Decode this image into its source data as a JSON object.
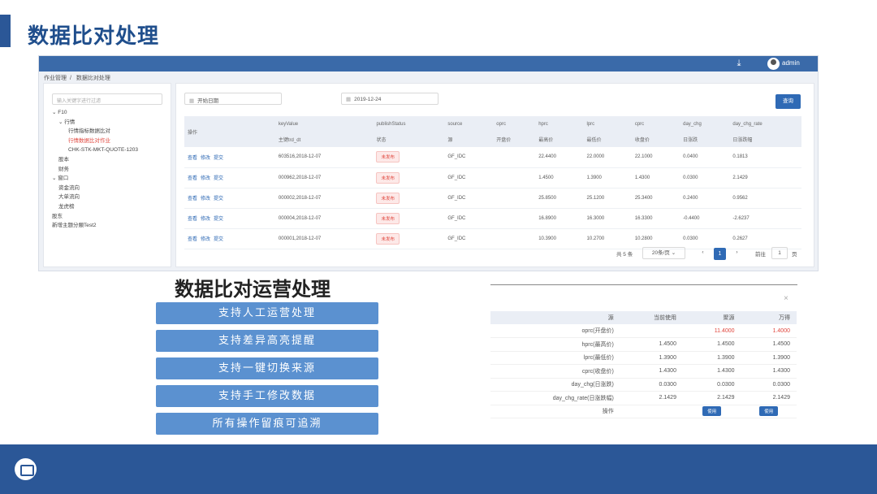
{
  "slide": {
    "title": "数据比对处理",
    "subtitle": "数据比对运营处理"
  },
  "topbar": {
    "user": "admin",
    "download_icon": "download-icon",
    "avatar_icon": "avatar-icon"
  },
  "breadcrumb": [
    "作业管理",
    "数据比对处理"
  ],
  "sidebar": {
    "search_placeholder": "输入关键字进行过滤",
    "tree": [
      {
        "label": "F10",
        "level": 0,
        "expanded": true
      },
      {
        "label": "行情",
        "level": 1,
        "expanded": true
      },
      {
        "label": "行情指标数据比对",
        "level": 2
      },
      {
        "label": "行情数据比对作业",
        "level": 2,
        "selected": true
      },
      {
        "label": "CHK-STK-MKT-QUOTE-1203",
        "level": 2
      },
      {
        "label": "股本",
        "level": 1
      },
      {
        "label": "财务",
        "level": 1
      },
      {
        "label": "窗口",
        "level": 0,
        "expanded": true
      },
      {
        "label": "资金流向",
        "level": 1
      },
      {
        "label": "大单流向",
        "level": 1
      },
      {
        "label": "龙虎榜",
        "level": 1
      },
      {
        "label": "股东",
        "level": 0
      },
      {
        "label": "新增主题分類Test2",
        "level": 0
      }
    ]
  },
  "filters": {
    "start_date_placeholder": "开始日期",
    "end_date": "2019-12-24",
    "query_label": "查询"
  },
  "table": {
    "headers": [
      {
        "top": "操作",
        "bottom": ""
      },
      {
        "top": "keyValue",
        "bottom": "主键trd_dt"
      },
      {
        "top": "publishStatus",
        "bottom": "状态"
      },
      {
        "top": "source",
        "bottom": "源"
      },
      {
        "top": "oprc",
        "bottom": "开盘价"
      },
      {
        "top": "hprc",
        "bottom": "最高价"
      },
      {
        "top": "lprc",
        "bottom": "最低价"
      },
      {
        "top": "cprc",
        "bottom": "收盘价"
      },
      {
        "top": "day_chg",
        "bottom": "日涨跌"
      },
      {
        "top": "day_chg_rate",
        "bottom": "日涨跌幅"
      }
    ],
    "ops": [
      "查看",
      "修改",
      "提交"
    ],
    "rows": [
      {
        "key": "603516,2018-12-07",
        "status": "未发布",
        "source": "GF_IDC",
        "oprc": "",
        "hprc": "22.4400",
        "lprc": "22.0000",
        "cprc": "22.1000",
        "day_chg": "0.0400",
        "day_chg_rate": "0.1813"
      },
      {
        "key": "000962,2018-12-07",
        "status": "未发布",
        "source": "GF_IDC",
        "oprc": "",
        "hprc": "1.4500",
        "lprc": "1.3900",
        "cprc": "1.4300",
        "day_chg": "0.0300",
        "day_chg_rate": "2.1429"
      },
      {
        "key": "000002,2018-12-07",
        "status": "未发布",
        "source": "GF_IDC",
        "oprc": "",
        "hprc": "25.8500",
        "lprc": "25.1200",
        "cprc": "25.3400",
        "day_chg": "0.2400",
        "day_chg_rate": "0.9562"
      },
      {
        "key": "000004,2018-12-07",
        "status": "未发布",
        "source": "GF_IDC",
        "oprc": "",
        "hprc": "16.8900",
        "lprc": "16.3000",
        "cprc": "16.3300",
        "day_chg": "-0.4400",
        "day_chg_rate": "-2.6237"
      },
      {
        "key": "000001,2018-12-07",
        "status": "未发布",
        "source": "GF_IDC",
        "oprc": "",
        "hprc": "10.3900",
        "lprc": "10.2700",
        "cprc": "10.2800",
        "day_chg": "0.0300",
        "day_chg_rate": "0.2627"
      }
    ]
  },
  "pagination": {
    "total": "共 5 条",
    "page_size": "20条/页",
    "current": "1",
    "goto_label": "前往",
    "goto_value": "1",
    "page_suffix": "页",
    "prev": "‹",
    "next": "›"
  },
  "features": [
    "支持人工运营处理",
    "支持差异高亮提醒",
    "支持一键切换来源",
    "支持手工修改数据",
    "所有操作留痕可追溯"
  ],
  "compare": {
    "close": "×",
    "headers": [
      "源",
      "当前使用",
      "聚源",
      "万得"
    ],
    "rows": [
      {
        "label": "oprc(开盘价)",
        "current": "",
        "juyuan": "11.4000",
        "wande": "1.4000",
        "highlight": true
      },
      {
        "label": "hprc(最高价)",
        "current": "1.4500",
        "juyuan": "1.4500",
        "wande": "1.4500"
      },
      {
        "label": "lprc(最低价)",
        "current": "1.3900",
        "juyuan": "1.3900",
        "wande": "1.3900"
      },
      {
        "label": "cprc(收盘价)",
        "current": "1.4300",
        "juyuan": "1.4300",
        "wande": "1.4300"
      },
      {
        "label": "day_chg(日涨跌)",
        "current": "0.0300",
        "juyuan": "0.0300",
        "wande": "0.0300"
      },
      {
        "label": "day_chg_rate(日涨跌幅)",
        "current": "2.1429",
        "juyuan": "2.1429",
        "wande": "2.1429"
      }
    ],
    "op_label": "操作",
    "use_label": "使用"
  }
}
